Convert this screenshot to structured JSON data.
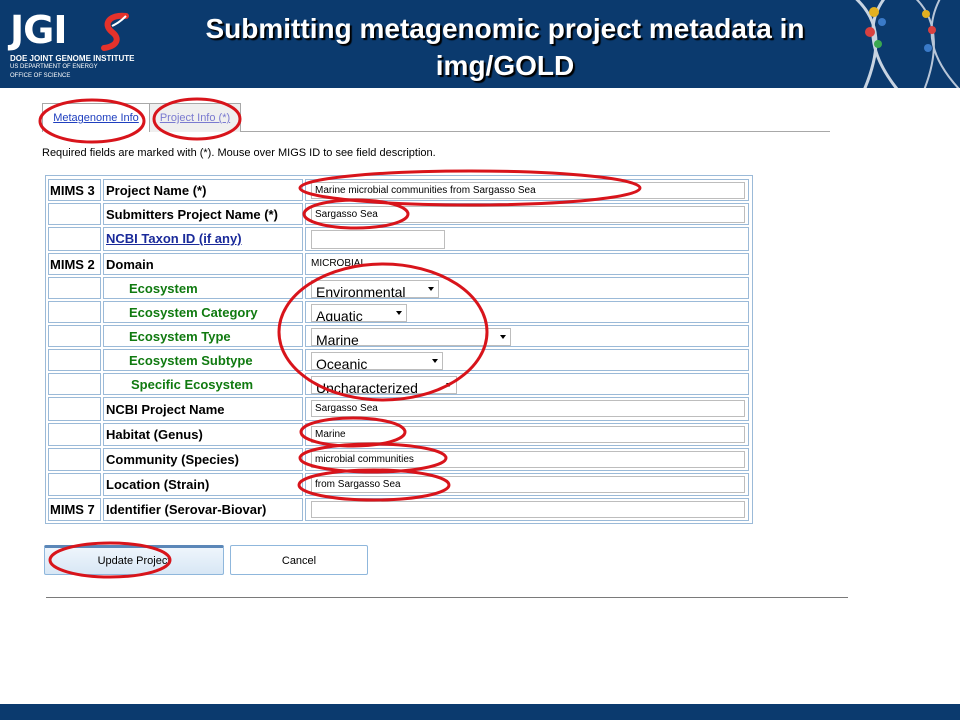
{
  "header": {
    "title": "Submitting metagenomic project metadata in img/GOLD",
    "logo": {
      "wordmark": "JGI",
      "line1": "DOE JOINT GENOME INSTITUTE",
      "line2": "US DEPARTMENT OF ENERGY",
      "line3": "OFFICE OF SCIENCE"
    }
  },
  "tabs": [
    {
      "label": "Metagenome Info",
      "active": true
    },
    {
      "label": "Project Info (*)",
      "active": false
    }
  ],
  "required_note": "Required fields are marked with (*). Mouse over MIGS ID to see field description.",
  "form": {
    "rows": [
      {
        "mims": "MIMS 3",
        "label": "Project Name (*)",
        "value": "Marine microbial communities from Sargasso Sea"
      },
      {
        "mims": "",
        "label": "Submitters Project Name (*)",
        "value": "Sargasso Sea"
      },
      {
        "mims": "",
        "label": "NCBI Taxon ID (if any)",
        "value": ""
      },
      {
        "mims": "MIMS 2",
        "label": "Domain",
        "value": "MICROBIAL"
      },
      {
        "mims": "",
        "label": "Ecosystem",
        "value": "Environmental"
      },
      {
        "mims": "",
        "label": "Ecosystem Category",
        "value": "Aquatic"
      },
      {
        "mims": "",
        "label": "Ecosystem Type",
        "value": "Marine"
      },
      {
        "mims": "",
        "label": "Ecosystem Subtype",
        "value": "Oceanic"
      },
      {
        "mims": "",
        "label": "Specific Ecosystem",
        "value": "Uncharacterized"
      },
      {
        "mims": "",
        "label": "NCBI Project Name",
        "value": "Sargasso Sea"
      },
      {
        "mims": "",
        "label": "Habitat (Genus)",
        "value": "Marine"
      },
      {
        "mims": "",
        "label": "Community (Species)",
        "value": "microbial communities"
      },
      {
        "mims": "",
        "label": "Location (Strain)",
        "value": "from Sargasso Sea"
      },
      {
        "mims": "MIMS 7",
        "label": "Identifier (Serovar-Biovar)",
        "value": ""
      }
    ]
  },
  "buttons": {
    "update": "Update Project",
    "cancel": "Cancel"
  },
  "colors": {
    "header_bg": "#0b3a6e",
    "annotation_red": "#d8141b",
    "ecosystem_label": "#107a10",
    "link_label": "#1a2a9a",
    "form_border": "#9bbad8"
  },
  "icons": [
    "jgi-logo-icon",
    "dna-helix-icon",
    "dropdown-arrow-icon"
  ]
}
